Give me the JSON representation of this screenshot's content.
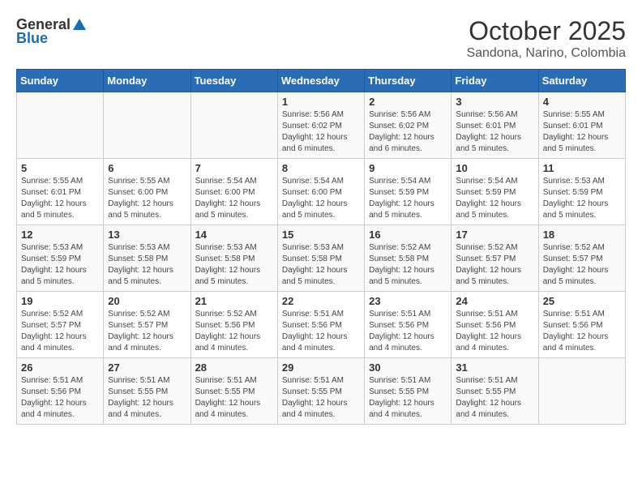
{
  "header": {
    "logo_general": "General",
    "logo_blue": "Blue",
    "month": "October 2025",
    "location": "Sandona, Narino, Colombia"
  },
  "days_of_week": [
    "Sunday",
    "Monday",
    "Tuesday",
    "Wednesday",
    "Thursday",
    "Friday",
    "Saturday"
  ],
  "weeks": [
    [
      {
        "day": "",
        "info": ""
      },
      {
        "day": "",
        "info": ""
      },
      {
        "day": "",
        "info": ""
      },
      {
        "day": "1",
        "info": "Sunrise: 5:56 AM\nSunset: 6:02 PM\nDaylight: 12 hours\nand 6 minutes."
      },
      {
        "day": "2",
        "info": "Sunrise: 5:56 AM\nSunset: 6:02 PM\nDaylight: 12 hours\nand 6 minutes."
      },
      {
        "day": "3",
        "info": "Sunrise: 5:56 AM\nSunset: 6:01 PM\nDaylight: 12 hours\nand 5 minutes."
      },
      {
        "day": "4",
        "info": "Sunrise: 5:55 AM\nSunset: 6:01 PM\nDaylight: 12 hours\nand 5 minutes."
      }
    ],
    [
      {
        "day": "5",
        "info": "Sunrise: 5:55 AM\nSunset: 6:01 PM\nDaylight: 12 hours\nand 5 minutes."
      },
      {
        "day": "6",
        "info": "Sunrise: 5:55 AM\nSunset: 6:00 PM\nDaylight: 12 hours\nand 5 minutes."
      },
      {
        "day": "7",
        "info": "Sunrise: 5:54 AM\nSunset: 6:00 PM\nDaylight: 12 hours\nand 5 minutes."
      },
      {
        "day": "8",
        "info": "Sunrise: 5:54 AM\nSunset: 6:00 PM\nDaylight: 12 hours\nand 5 minutes."
      },
      {
        "day": "9",
        "info": "Sunrise: 5:54 AM\nSunset: 5:59 PM\nDaylight: 12 hours\nand 5 minutes."
      },
      {
        "day": "10",
        "info": "Sunrise: 5:54 AM\nSunset: 5:59 PM\nDaylight: 12 hours\nand 5 minutes."
      },
      {
        "day": "11",
        "info": "Sunrise: 5:53 AM\nSunset: 5:59 PM\nDaylight: 12 hours\nand 5 minutes."
      }
    ],
    [
      {
        "day": "12",
        "info": "Sunrise: 5:53 AM\nSunset: 5:59 PM\nDaylight: 12 hours\nand 5 minutes."
      },
      {
        "day": "13",
        "info": "Sunrise: 5:53 AM\nSunset: 5:58 PM\nDaylight: 12 hours\nand 5 minutes."
      },
      {
        "day": "14",
        "info": "Sunrise: 5:53 AM\nSunset: 5:58 PM\nDaylight: 12 hours\nand 5 minutes."
      },
      {
        "day": "15",
        "info": "Sunrise: 5:53 AM\nSunset: 5:58 PM\nDaylight: 12 hours\nand 5 minutes."
      },
      {
        "day": "16",
        "info": "Sunrise: 5:52 AM\nSunset: 5:58 PM\nDaylight: 12 hours\nand 5 minutes."
      },
      {
        "day": "17",
        "info": "Sunrise: 5:52 AM\nSunset: 5:57 PM\nDaylight: 12 hours\nand 5 minutes."
      },
      {
        "day": "18",
        "info": "Sunrise: 5:52 AM\nSunset: 5:57 PM\nDaylight: 12 hours\nand 5 minutes."
      }
    ],
    [
      {
        "day": "19",
        "info": "Sunrise: 5:52 AM\nSunset: 5:57 PM\nDaylight: 12 hours\nand 4 minutes."
      },
      {
        "day": "20",
        "info": "Sunrise: 5:52 AM\nSunset: 5:57 PM\nDaylight: 12 hours\nand 4 minutes."
      },
      {
        "day": "21",
        "info": "Sunrise: 5:52 AM\nSunset: 5:56 PM\nDaylight: 12 hours\nand 4 minutes."
      },
      {
        "day": "22",
        "info": "Sunrise: 5:51 AM\nSunset: 5:56 PM\nDaylight: 12 hours\nand 4 minutes."
      },
      {
        "day": "23",
        "info": "Sunrise: 5:51 AM\nSunset: 5:56 PM\nDaylight: 12 hours\nand 4 minutes."
      },
      {
        "day": "24",
        "info": "Sunrise: 5:51 AM\nSunset: 5:56 PM\nDaylight: 12 hours\nand 4 minutes."
      },
      {
        "day": "25",
        "info": "Sunrise: 5:51 AM\nSunset: 5:56 PM\nDaylight: 12 hours\nand 4 minutes."
      }
    ],
    [
      {
        "day": "26",
        "info": "Sunrise: 5:51 AM\nSunset: 5:56 PM\nDaylight: 12 hours\nand 4 minutes."
      },
      {
        "day": "27",
        "info": "Sunrise: 5:51 AM\nSunset: 5:55 PM\nDaylight: 12 hours\nand 4 minutes."
      },
      {
        "day": "28",
        "info": "Sunrise: 5:51 AM\nSunset: 5:55 PM\nDaylight: 12 hours\nand 4 minutes."
      },
      {
        "day": "29",
        "info": "Sunrise: 5:51 AM\nSunset: 5:55 PM\nDaylight: 12 hours\nand 4 minutes."
      },
      {
        "day": "30",
        "info": "Sunrise: 5:51 AM\nSunset: 5:55 PM\nDaylight: 12 hours\nand 4 minutes."
      },
      {
        "day": "31",
        "info": "Sunrise: 5:51 AM\nSunset: 5:55 PM\nDaylight: 12 hours\nand 4 minutes."
      },
      {
        "day": "",
        "info": ""
      }
    ]
  ]
}
